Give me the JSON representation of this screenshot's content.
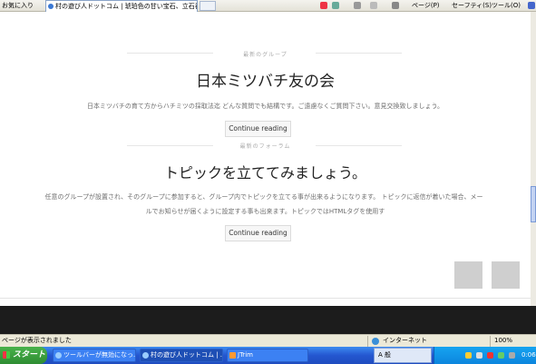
{
  "browser": {
    "favorites_label": "お気に入り",
    "active_tab": "村の遊び人ドットコム | 琥珀色の甘い宝石、立石養蜂...",
    "toolbar": {
      "page_menu": "ページ(P)",
      "safety_menu": "セーフティ(S)",
      "tools_menu": "ツール(O)"
    }
  },
  "page": {
    "group": {
      "kicker": "最新のグループ",
      "title": "日本ミツバチ友の会",
      "description": "日本ミツバチの育て方からハチミツの採取法迄 どんな質問でも結構です。ご遠慮なくご質問下さい。意見交換致しましょう。",
      "button": "Continue reading"
    },
    "forum": {
      "kicker": "最新のフォーラム",
      "title": "トピックを立ててみましょう。",
      "description_line1": "任意のグループが設置され、そのグループに参加すると、グループ内でトピックを立てる事が出来るようになります。 トピックに返信が着いた場合、メー",
      "description_line2": "ルでお知らせが届くように設定する事も出来ます。トピックではHTMLタグを使用す",
      "button": "Continue reading"
    }
  },
  "status": {
    "text": "ページが表示されました",
    "zone": "インターネット",
    "zoom": "100%"
  },
  "taskbar": {
    "start": "スタート",
    "tasks": [
      "ツールバーが無効になっ...",
      "村の遊び人ドットコム | ...",
      "JTrim"
    ],
    "ime": "A 般",
    "clock": "0:06"
  }
}
